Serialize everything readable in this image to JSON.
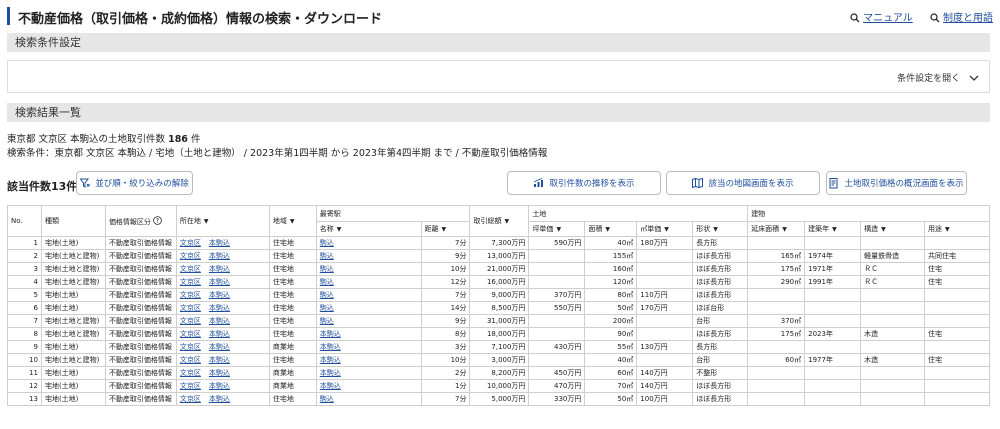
{
  "header": {
    "title": "不動産価格（取引価格・成約価格）情報の検索・ダウンロード",
    "manual_link": "マニュアル",
    "terms_link": "制度と用語"
  },
  "search_conditions": {
    "heading": "検索条件設定",
    "open_label": "条件設定を開く"
  },
  "results": {
    "heading": "検索結果一覧",
    "summary_prefix": "東京都 文京区 本駒込の土地取引件数",
    "summary_count": "186",
    "summary_unit": "件",
    "conditions_line": "検索条件：東京都 文京区 本駒込 / 宅地（土地と建物） / 2023年第1四半期 から 2023年第4四半期 まで / 不動産取引価格情報",
    "count_label": "該当件数13件",
    "clear_button": "並び順・絞り込みの解除",
    "trend_button": "取引件数の推移を表示",
    "map_button": "該当の地図画面を表示",
    "overview_button": "土地取引価格の概況画面を表示"
  },
  "table": {
    "group_headers": {
      "station": "最寄駅",
      "land": "土地",
      "building": "建物"
    },
    "headers": {
      "no": "No.",
      "type": "種類",
      "category": "価格情報区分",
      "location": "所在地",
      "district": "地域",
      "station_name": "名称",
      "distance": "距離",
      "total_price": "取引総額",
      "tsubo_price": "坪単価",
      "area": "面積",
      "sqm_price": "㎡単価",
      "shape": "形状",
      "floor_area": "延床面積",
      "built_year": "建築年",
      "structure": "構造",
      "use": "用途"
    },
    "rows": [
      {
        "no": "1",
        "type": "宅地(土地)",
        "category": "不動産取引価格情報",
        "ward": "文京区",
        "town": "本駒込",
        "district": "住宅地",
        "station": "駒込",
        "distance": "7分",
        "price": "7,300万円",
        "tsubo": "590万円",
        "area": "40㎡",
        "sqm": "180万円",
        "shape": "長方形",
        "floor": "",
        "year": "",
        "structure": "",
        "use": ""
      },
      {
        "no": "2",
        "type": "宅地(土地と建物)",
        "category": "不動産取引価格情報",
        "ward": "文京区",
        "town": "本駒込",
        "district": "住宅地",
        "station": "駒込",
        "distance": "9分",
        "price": "13,000万円",
        "tsubo": "",
        "area": "155㎡",
        "sqm": "",
        "shape": "ほぼ長方形",
        "floor": "165㎡",
        "year": "1974年",
        "structure": "軽量鉄骨造",
        "use": "共同住宅"
      },
      {
        "no": "3",
        "type": "宅地(土地と建物)",
        "category": "不動産取引価格情報",
        "ward": "文京区",
        "town": "本駒込",
        "district": "住宅地",
        "station": "駒込",
        "distance": "10分",
        "price": "21,000万円",
        "tsubo": "",
        "area": "160㎡",
        "sqm": "",
        "shape": "ほぼ長方形",
        "floor": "175㎡",
        "year": "1971年",
        "structure": "ＲＣ",
        "use": "住宅"
      },
      {
        "no": "4",
        "type": "宅地(土地と建物)",
        "category": "不動産取引価格情報",
        "ward": "文京区",
        "town": "本駒込",
        "district": "住宅地",
        "station": "駒込",
        "distance": "12分",
        "price": "16,000万円",
        "tsubo": "",
        "area": "120㎡",
        "sqm": "",
        "shape": "ほぼ長方形",
        "floor": "290㎡",
        "year": "1991年",
        "structure": "ＲＣ",
        "use": "住宅"
      },
      {
        "no": "5",
        "type": "宅地(土地)",
        "category": "不動産取引価格情報",
        "ward": "文京区",
        "town": "本駒込",
        "district": "住宅地",
        "station": "駒込",
        "distance": "7分",
        "price": "9,000万円",
        "tsubo": "370万円",
        "area": "80㎡",
        "sqm": "110万円",
        "shape": "ほぼ長方形",
        "floor": "",
        "year": "",
        "structure": "",
        "use": ""
      },
      {
        "no": "6",
        "type": "宅地(土地)",
        "category": "不動産取引価格情報",
        "ward": "文京区",
        "town": "本駒込",
        "district": "住宅地",
        "station": "駒込",
        "distance": "14分",
        "price": "8,500万円",
        "tsubo": "550万円",
        "area": "50㎡",
        "sqm": "170万円",
        "shape": "ほぼ台形",
        "floor": "",
        "year": "",
        "structure": "",
        "use": ""
      },
      {
        "no": "7",
        "type": "宅地(土地と建物)",
        "category": "不動産取引価格情報",
        "ward": "文京区",
        "town": "本駒込",
        "district": "住宅地",
        "station": "駒込",
        "distance": "9分",
        "price": "31,000万円",
        "tsubo": "",
        "area": "200㎡",
        "sqm": "",
        "shape": "台形",
        "floor": "370㎡",
        "year": "",
        "structure": "",
        "use": ""
      },
      {
        "no": "8",
        "type": "宅地(土地と建物)",
        "category": "不動産取引価格情報",
        "ward": "文京区",
        "town": "本駒込",
        "district": "住宅地",
        "station": "本駒込",
        "distance": "8分",
        "price": "18,000万円",
        "tsubo": "",
        "area": "90㎡",
        "sqm": "",
        "shape": "ほぼ長方形",
        "floor": "175㎡",
        "year": "2023年",
        "structure": "木造",
        "use": "住宅"
      },
      {
        "no": "9",
        "type": "宅地(土地)",
        "category": "不動産取引価格情報",
        "ward": "文京区",
        "town": "本駒込",
        "district": "商業地",
        "station": "本駒込",
        "distance": "3分",
        "price": "7,100万円",
        "tsubo": "430万円",
        "area": "55㎡",
        "sqm": "130万円",
        "shape": "長方形",
        "floor": "",
        "year": "",
        "structure": "",
        "use": ""
      },
      {
        "no": "10",
        "type": "宅地(土地と建物)",
        "category": "不動産取引価格情報",
        "ward": "文京区",
        "town": "本駒込",
        "district": "住宅地",
        "station": "本駒込",
        "distance": "10分",
        "price": "3,000万円",
        "tsubo": "",
        "area": "40㎡",
        "sqm": "",
        "shape": "台形",
        "floor": "60㎡",
        "year": "1977年",
        "structure": "木造",
        "use": "住宅"
      },
      {
        "no": "11",
        "type": "宅地(土地)",
        "category": "不動産取引価格情報",
        "ward": "文京区",
        "town": "本駒込",
        "district": "商業地",
        "station": "本駒込",
        "distance": "2分",
        "price": "8,200万円",
        "tsubo": "450万円",
        "area": "60㎡",
        "sqm": "140万円",
        "shape": "不整形",
        "floor": "",
        "year": "",
        "structure": "",
        "use": ""
      },
      {
        "no": "12",
        "type": "宅地(土地)",
        "category": "不動産取引価格情報",
        "ward": "文京区",
        "town": "本駒込",
        "district": "商業地",
        "station": "本駒込",
        "distance": "1分",
        "price": "10,000万円",
        "tsubo": "470万円",
        "area": "70㎡",
        "sqm": "140万円",
        "shape": "ほぼ長方形",
        "floor": "",
        "year": "",
        "structure": "",
        "use": ""
      },
      {
        "no": "13",
        "type": "宅地(土地)",
        "category": "不動産取引価格情報",
        "ward": "文京区",
        "town": "本駒込",
        "district": "住宅地",
        "station": "駒込",
        "distance": "7分",
        "price": "5,000万円",
        "tsubo": "330万円",
        "area": "50㎡",
        "sqm": "100万円",
        "shape": "ほぼ長方形",
        "floor": "",
        "year": "",
        "structure": "",
        "use": ""
      }
    ]
  },
  "colors": {
    "accent": "#1f4e9c",
    "band": "#e6e6e6",
    "border": "#cfcfcf"
  }
}
